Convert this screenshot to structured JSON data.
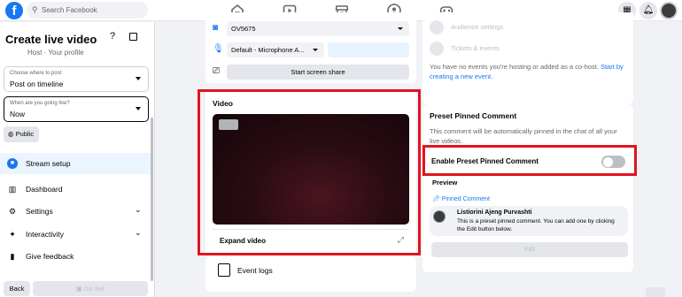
{
  "topbar": {
    "logo": "f",
    "search_placeholder": "Search Facebook",
    "nav_icons": [
      "home-icon",
      "video-icon",
      "marketplace-icon",
      "groups-icon",
      "gaming-icon"
    ],
    "right_icons": [
      "menu-grid-icon",
      "notifications-bell-icon",
      "profile-avatar"
    ]
  },
  "sidebar": {
    "title": "Create live video",
    "help_icon": "?",
    "profile_subtitle": "Host · Your profile",
    "post_where": {
      "label": "Choose where to post",
      "value": "Post on timeline"
    },
    "going_live": {
      "label": "When are you going live?",
      "value": "Now"
    },
    "audience": "Public",
    "menu": [
      {
        "label": "Stream setup",
        "icon": "live-camera-icon",
        "selected": true
      },
      {
        "label": "Dashboard",
        "icon": "dashboard-icon"
      },
      {
        "label": "Settings",
        "icon": "gear-icon",
        "chevron": true
      },
      {
        "label": "Interactivity",
        "icon": "sparkle-icon",
        "chevron": true
      },
      {
        "label": "Give feedback",
        "icon": "feedback-icon"
      }
    ],
    "back_label": "Back",
    "go_live_label": "Go live"
  },
  "setup": {
    "camera": "OV5675",
    "microphone": "Default - Microphone A...",
    "screen_share_label": "Start screen share"
  },
  "video": {
    "title": "Video",
    "expand_label": "Expand video"
  },
  "events": {
    "label": "Event logs"
  },
  "right_panel": {
    "audience_settings": "Audience settings",
    "tickets_events": "Tickets & events",
    "no_events_text": "You have no events you're hosting or added as a co-host.",
    "no_events_link": "Start by creating a new event."
  },
  "pinned": {
    "title": "Preset Pinned Comment",
    "description": "This comment will be automatically pinned in the chat of all your live videos.",
    "toggle_label": "Enable Preset Pinned Comment",
    "toggle_on": false,
    "preview_label": "Preview",
    "pinned_label": "Pinned Comment",
    "author": "Listiorini Ajeng Purvashti",
    "message": "This is a preset pinned comment. You can add one by clicking the Edit button below.",
    "edit_label": "Edit"
  },
  "colors": {
    "brand": "#1877f2",
    "highlight": "#e2141f"
  }
}
